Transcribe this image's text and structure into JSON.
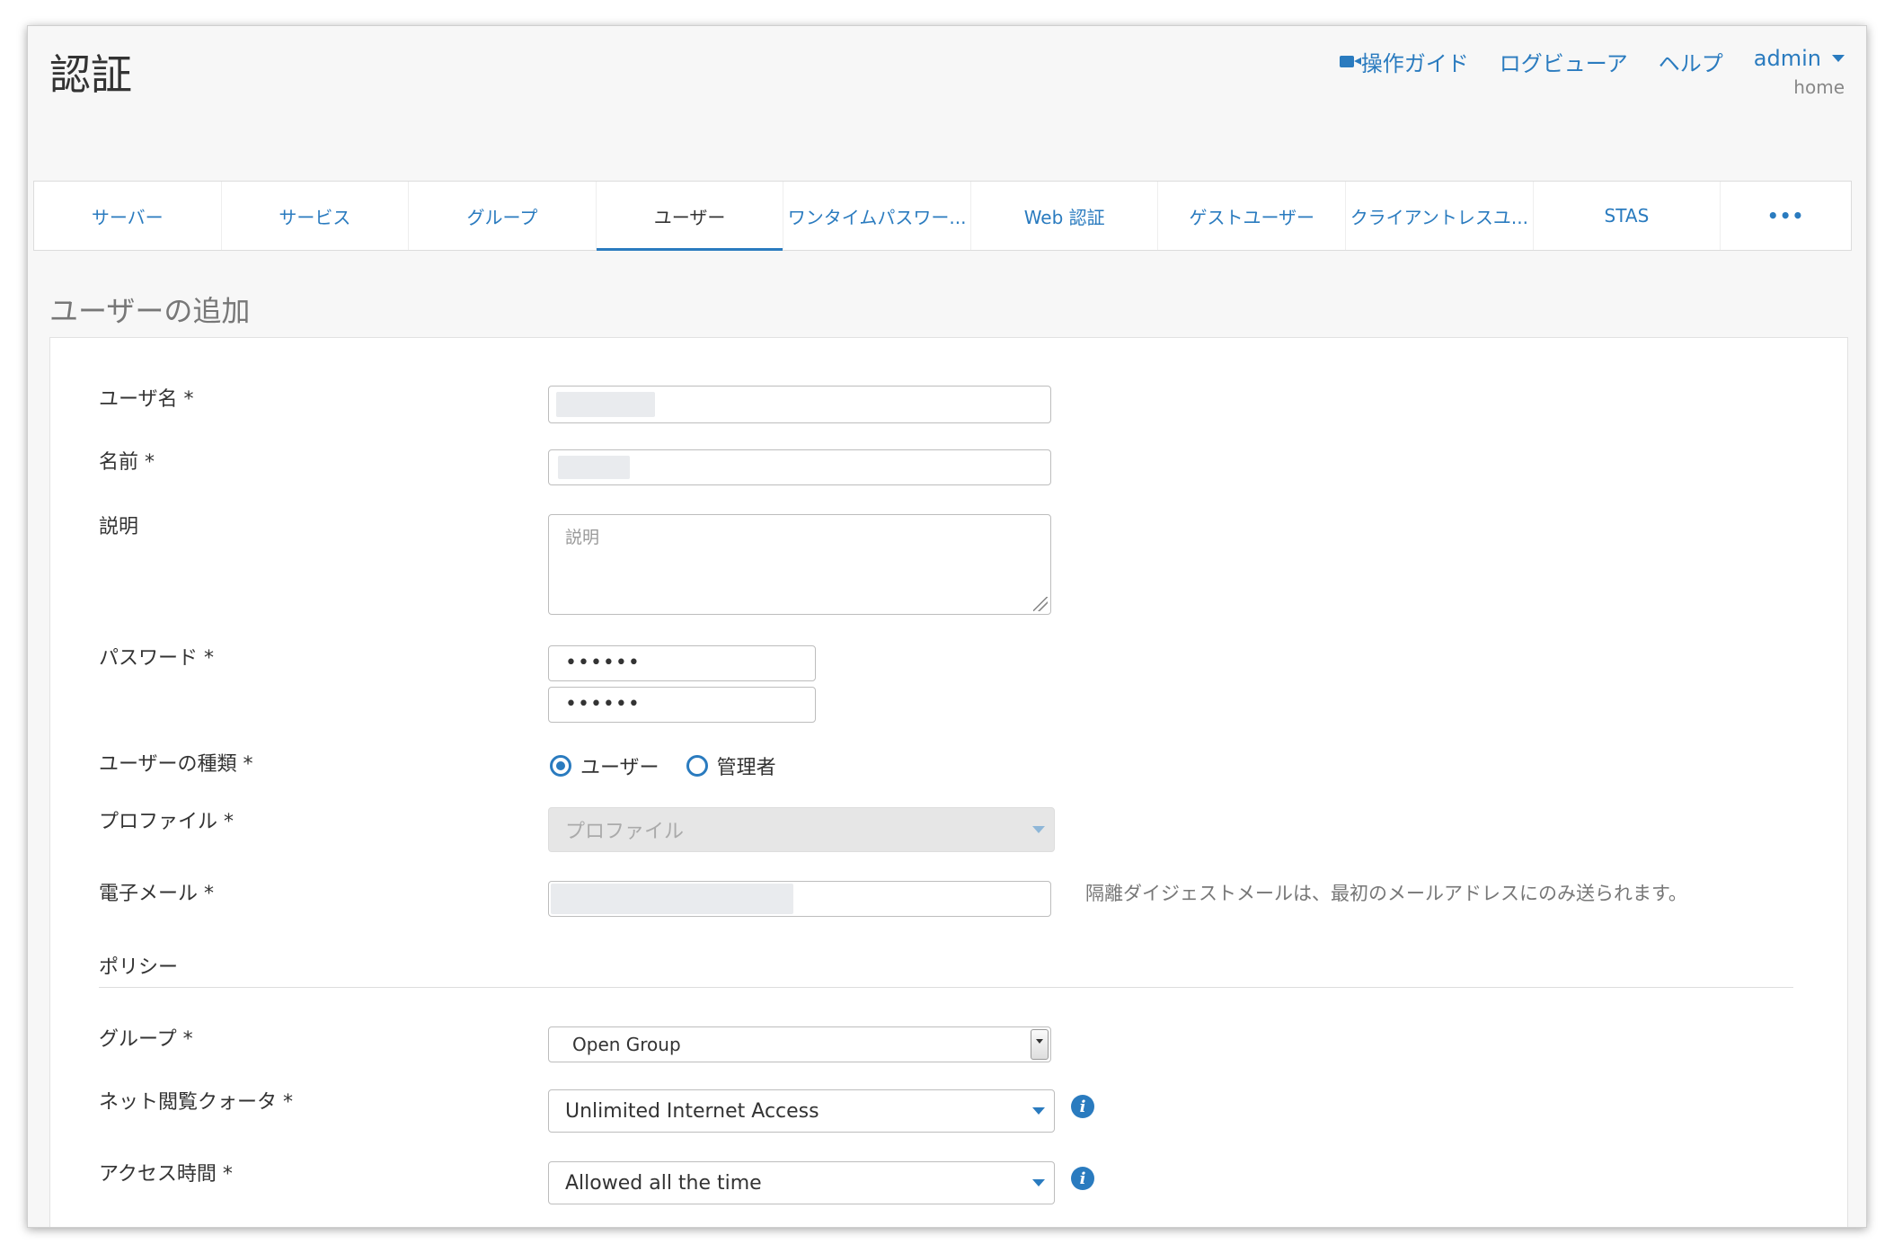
{
  "header": {
    "title": "認証",
    "nav": {
      "guide": "操作ガイド",
      "log_viewer": "ログビューア",
      "help": "ヘルプ",
      "user": "admin",
      "user_sub": "home"
    }
  },
  "tabs": [
    {
      "label": "サーバー"
    },
    {
      "label": "サービス"
    },
    {
      "label": "グループ"
    },
    {
      "label": "ユーザー",
      "active": true
    },
    {
      "label": "ワンタイムパスワー..."
    },
    {
      "label": "Web 認証"
    },
    {
      "label": "ゲストユーザー"
    },
    {
      "label": "クライアントレスユ..."
    },
    {
      "label": "STAS"
    },
    {
      "label": "•••"
    }
  ],
  "form": {
    "section_title": "ユーザーの追加",
    "username": {
      "label": "ユーザ名 *",
      "value": ""
    },
    "name": {
      "label": "名前 *",
      "value": ""
    },
    "description": {
      "label": "説明",
      "placeholder": "説明"
    },
    "password": {
      "label": "パスワード *",
      "value": "••••••",
      "confirm_value": "••••••"
    },
    "user_type": {
      "label": "ユーザーの種類 *",
      "options": [
        "ユーザー",
        "管理者"
      ],
      "selected": "ユーザー"
    },
    "profile": {
      "label": "プロファイル *",
      "value": "プロファイル",
      "disabled": true
    },
    "email": {
      "label": "電子メール *",
      "value": "",
      "help": "隔離ダイジェストメールは、最初のメールアドレスにのみ送られます。"
    },
    "policy": {
      "heading": "ポリシー",
      "group": {
        "label": "グループ *",
        "value": "Open Group"
      },
      "quota": {
        "label": "ネット閲覧クォータ *",
        "value": "Unlimited Internet Access"
      },
      "access_time": {
        "label": "アクセス時間 *",
        "value": "Allowed all the time"
      }
    }
  },
  "colors": {
    "accent": "#2a7bbf",
    "background": "#f7f7f7"
  }
}
